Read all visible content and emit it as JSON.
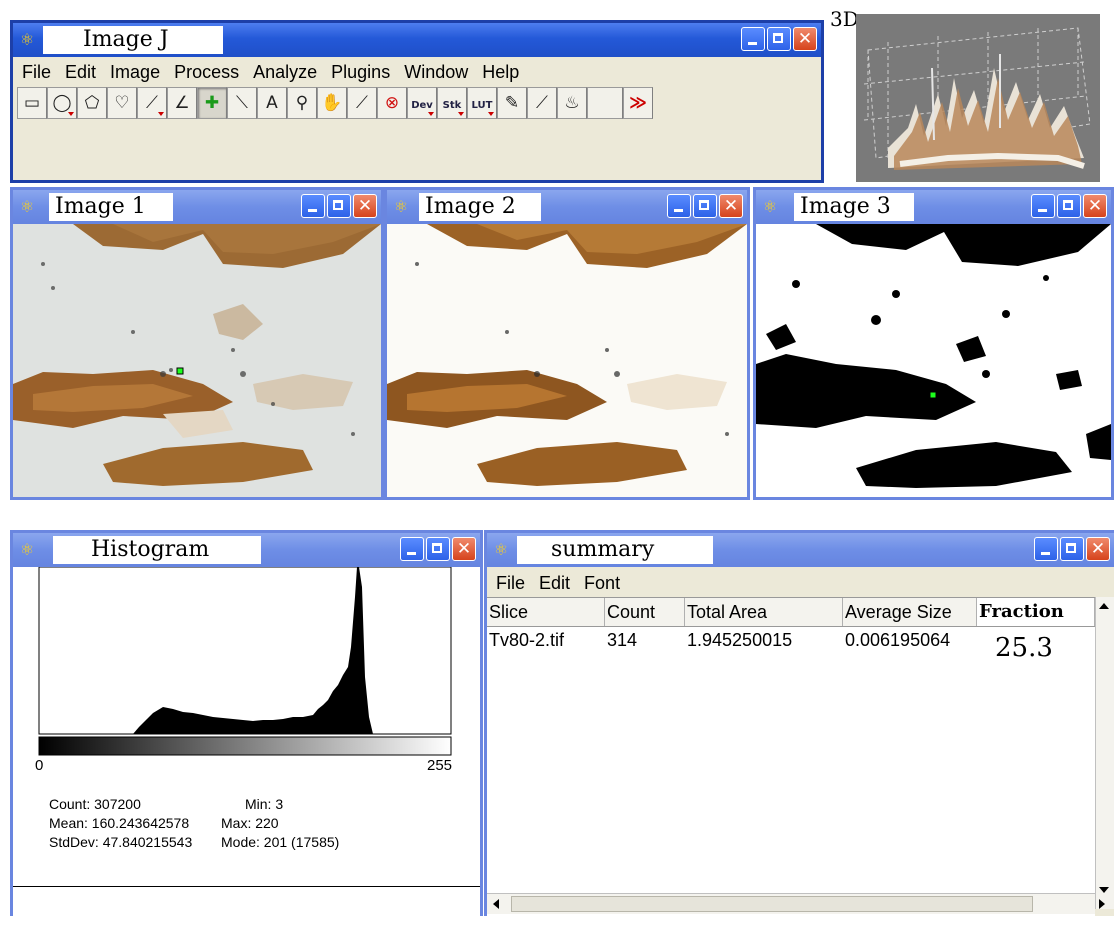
{
  "main_window": {
    "title": "Image J",
    "menu": [
      "File",
      "Edit",
      "Image",
      "Process",
      "Analyze",
      "Plugins",
      "Window",
      "Help"
    ],
    "tools": [
      {
        "name": "rectangle-tool-icon",
        "glyph": "▭"
      },
      {
        "name": "oval-tool-icon",
        "glyph": "◯"
      },
      {
        "name": "polygon-tool-icon",
        "glyph": "⬠"
      },
      {
        "name": "freehand-tool-icon",
        "glyph": "♡"
      },
      {
        "name": "line-tool-icon",
        "glyph": "⟋"
      },
      {
        "name": "angle-tool-icon",
        "glyph": "∠"
      },
      {
        "name": "point-tool-icon",
        "glyph": "✚"
      },
      {
        "name": "wand-tool-icon",
        "glyph": "⟍"
      },
      {
        "name": "text-tool-icon",
        "glyph": "A"
      },
      {
        "name": "magnifier-tool-icon",
        "glyph": "⚲"
      },
      {
        "name": "hand-tool-icon",
        "glyph": "✋"
      },
      {
        "name": "dropper-tool-icon",
        "glyph": "⟋"
      },
      {
        "name": "stop-tool-icon",
        "glyph": "⊗"
      },
      {
        "name": "dev-tool-icon",
        "glyph": "Dev"
      },
      {
        "name": "stk-tool-icon",
        "glyph": "Stk"
      },
      {
        "name": "lut-tool-icon",
        "glyph": "LUT"
      },
      {
        "name": "pencil-tool-icon",
        "glyph": "✎"
      },
      {
        "name": "brush-tool-icon",
        "glyph": "⟋"
      },
      {
        "name": "flood-fill-tool-icon",
        "glyph": "♨"
      },
      {
        "name": "blank-tool-icon",
        "glyph": ""
      },
      {
        "name": "more-tools-icon",
        "glyph": "≫"
      }
    ]
  },
  "plot3d": {
    "label": "3D"
  },
  "image1": {
    "title": "Image 1"
  },
  "image2": {
    "title": "Image 2"
  },
  "image3": {
    "title": "Image 3"
  },
  "histogram": {
    "title": "Histogram",
    "axis_min": "0",
    "axis_max": "255",
    "count": "Count: 307200",
    "min": "Min: 3",
    "mean": "Mean: 160.243642578",
    "max": "Max: 220",
    "stddev": "StdDev: 47.840215543",
    "mode": "Mode: 201 (17585)"
  },
  "summary": {
    "title": "summary",
    "menu": [
      "File",
      "Edit",
      "Font"
    ],
    "columns": [
      "Slice",
      "Count",
      "Total Area",
      "Average Size",
      "Fraction"
    ],
    "row": [
      "Tv80-2.tif",
      "314",
      "1.945250015",
      "0.006195064",
      "25.3"
    ]
  },
  "colors": {
    "titlebar_active": "#2459d8",
    "titlebar_inactive": "#6e8ee6",
    "close_button": "#d6431c",
    "stain_brown": "#a2601c"
  }
}
